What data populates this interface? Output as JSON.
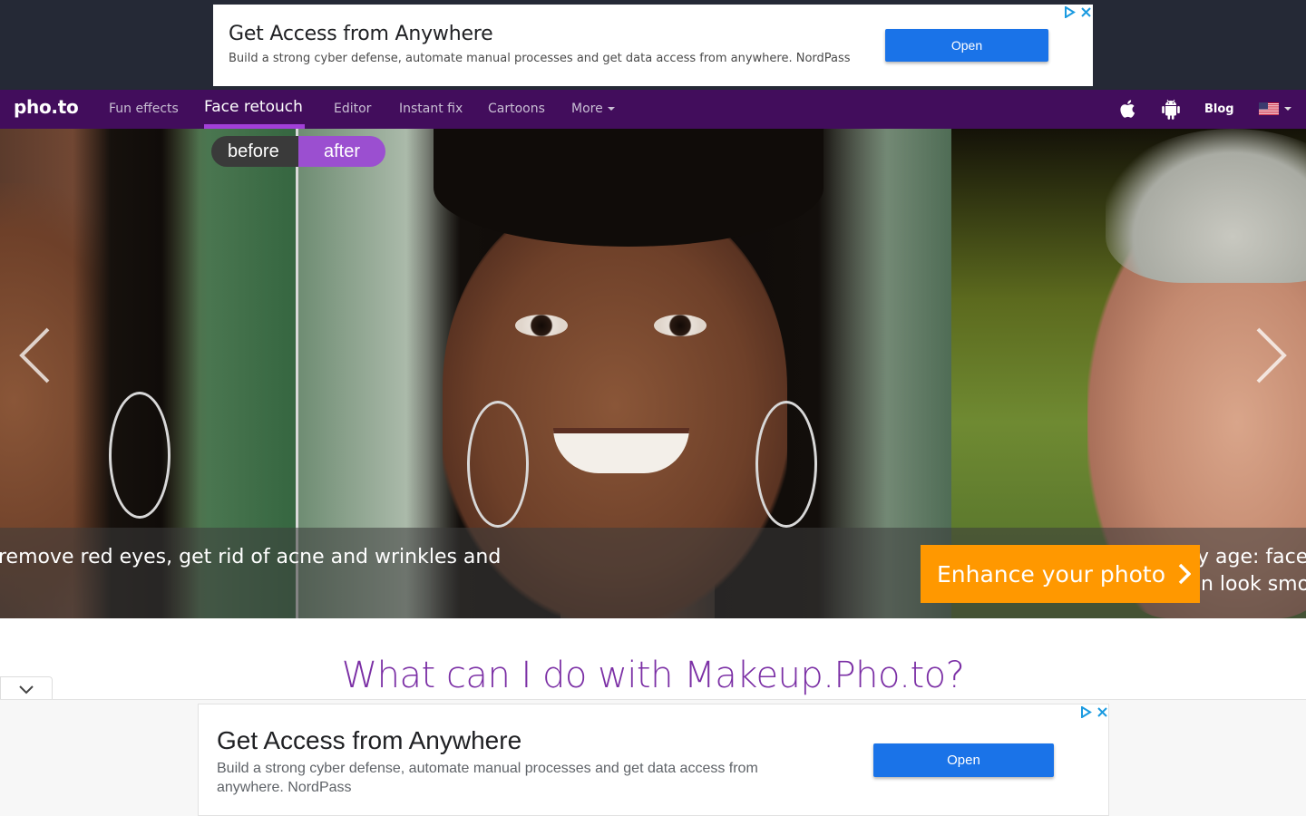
{
  "ads": {
    "top": {
      "title": "Get Access from Anywhere",
      "description": "Build a strong cyber defense, automate manual processes and get data access from anywhere. NordPass",
      "open_label": "Open"
    },
    "bottom": {
      "title": "Get Access from Anywhere",
      "description": "Build a strong cyber defense, automate manual processes and get data access from anywhere. NordPass",
      "open_label": "Open"
    }
  },
  "nav": {
    "logo": "pho.to",
    "items": [
      {
        "label": "Fun effects"
      },
      {
        "label": "Face retouch",
        "active": true
      },
      {
        "label": "Editor"
      },
      {
        "label": "Instant fix"
      },
      {
        "label": "Cartoons"
      },
      {
        "label": "More"
      }
    ],
    "blog_label": "Blog",
    "icons": [
      "apple-icon",
      "android-icon",
      "us-flag-icon"
    ]
  },
  "hero": {
    "toggle": {
      "before": "before",
      "after": "after"
    },
    "caption_left": "remove red eyes, get rid of acne and wrinkles and",
    "caption_right_line1": "y age: face",
    "caption_right_line2": "n look smo",
    "cta_label": "Enhance your photo"
  },
  "section": {
    "title": "What can I do with Makeup.Pho.to?"
  },
  "colors": {
    "nav_bg": "#420d5c",
    "accent_purple": "#9b4fd0",
    "cta_orange": "#ff9800",
    "ad_button_blue": "#1a73e8",
    "title_purple": "#7b2fa5"
  }
}
